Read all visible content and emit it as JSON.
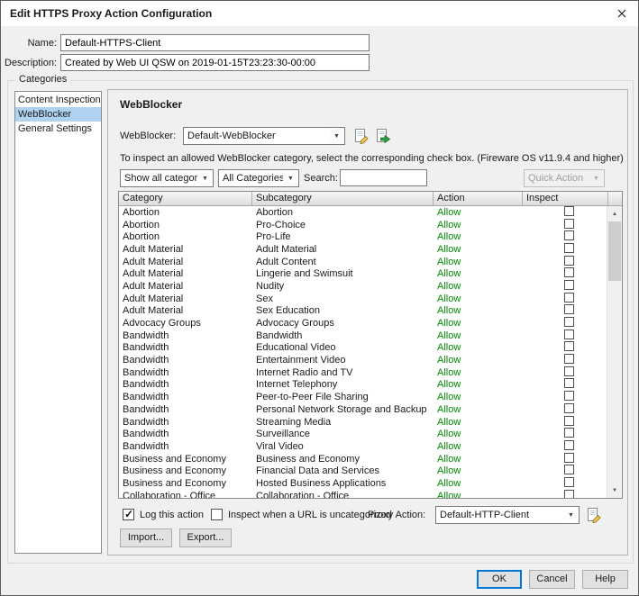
{
  "window": {
    "title": "Edit HTTPS Proxy Action Configuration"
  },
  "icons": {
    "close": "close-icon",
    "edit_webblocker": "page-edit-icon",
    "view_webblocker": "page-go-icon",
    "edit_proxy_action": "page-edit-icon",
    "combo_arrow": "chevron-down-icon",
    "scroll_up": "arrow-up-icon",
    "scroll_down": "arrow-down-icon"
  },
  "fields": {
    "name_label": "Name:",
    "name_value": "Default-HTTPS-Client",
    "description_label": "Description:",
    "description_value": "Created by Web UI QSW on 2019-01-15T23:23:30-00:00"
  },
  "categories": {
    "group_label": "Categories",
    "selected_index": 1,
    "items": [
      {
        "label": "Content Inspection"
      },
      {
        "label": "WebBlocker"
      },
      {
        "label": "General Settings"
      }
    ]
  },
  "webblocker": {
    "heading": "WebBlocker",
    "selector_label": "WebBlocker:",
    "selector_value": "Default-WebBlocker",
    "instruction": "To inspect an allowed WebBlocker category, select the corresponding check box. (Fireware OS v11.9.4 and higher)",
    "show_filter_value": "Show all categories",
    "category_filter_value": "All Categories",
    "search_label": "Search:",
    "search_value": "",
    "quick_action_label": "Quick Action",
    "table": {
      "headers": [
        "Category",
        "Subcategory",
        "Action",
        "Inspect"
      ],
      "action_color": "#008a00",
      "rows": [
        [
          "Abortion",
          "Abortion",
          "Allow"
        ],
        [
          "Abortion",
          "Pro-Choice",
          "Allow"
        ],
        [
          "Abortion",
          "Pro-Life",
          "Allow"
        ],
        [
          "Adult Material",
          "Adult Material",
          "Allow"
        ],
        [
          "Adult Material",
          "Adult Content",
          "Allow"
        ],
        [
          "Adult Material",
          "Lingerie and Swimsuit",
          "Allow"
        ],
        [
          "Adult Material",
          "Nudity",
          "Allow"
        ],
        [
          "Adult Material",
          "Sex",
          "Allow"
        ],
        [
          "Adult Material",
          "Sex Education",
          "Allow"
        ],
        [
          "Advocacy Groups",
          "Advocacy Groups",
          "Allow"
        ],
        [
          "Bandwidth",
          "Bandwidth",
          "Allow"
        ],
        [
          "Bandwidth",
          "Educational Video",
          "Allow"
        ],
        [
          "Bandwidth",
          "Entertainment Video",
          "Allow"
        ],
        [
          "Bandwidth",
          "Internet Radio and TV",
          "Allow"
        ],
        [
          "Bandwidth",
          "Internet Telephony",
          "Allow"
        ],
        [
          "Bandwidth",
          "Peer-to-Peer File Sharing",
          "Allow"
        ],
        [
          "Bandwidth",
          "Personal Network Storage and Backup",
          "Allow"
        ],
        [
          "Bandwidth",
          "Streaming Media",
          "Allow"
        ],
        [
          "Bandwidth",
          "Surveillance",
          "Allow"
        ],
        [
          "Bandwidth",
          "Viral Video",
          "Allow"
        ],
        [
          "Business and Economy",
          "Business and Economy",
          "Allow"
        ],
        [
          "Business and Economy",
          "Financial Data and Services",
          "Allow"
        ],
        [
          "Business and Economy",
          "Hosted Business Applications",
          "Allow"
        ],
        [
          "Collaboration - Office",
          "Collaboration - Office",
          "Allow"
        ]
      ]
    },
    "log_action_label": "Log this action",
    "log_action_checked": true,
    "inspect_uncategorized_label": "Inspect when a URL is uncategorized",
    "inspect_uncategorized_checked": false,
    "proxy_action_label": "Proxy Action:",
    "proxy_action_value": "Default-HTTP-Client",
    "import_label": "Import...",
    "export_label": "Export..."
  },
  "footer": {
    "ok_label": "OK",
    "cancel_label": "Cancel",
    "help_label": "Help"
  }
}
